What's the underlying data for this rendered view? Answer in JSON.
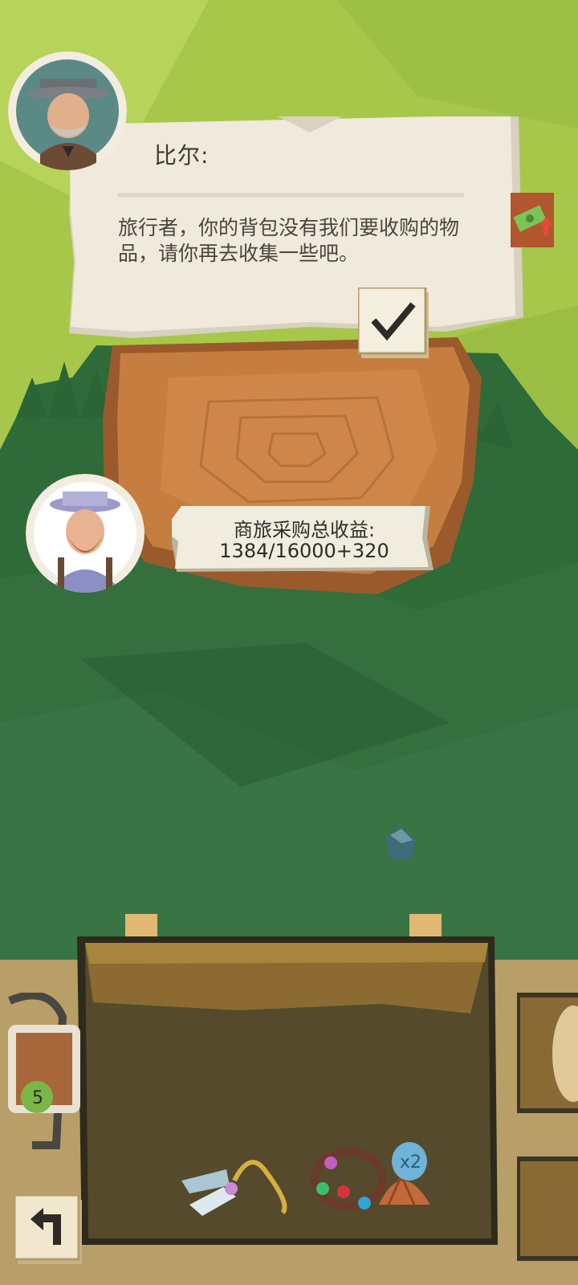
{
  "dialog": {
    "speaker": "比尔:",
    "message": "旅行者，你的背包没有我们要收购的物品，请你再去收集一些吧。",
    "confirm_icon": "checkmark-icon"
  },
  "earnings": {
    "title": "商旅采购总收益:",
    "value": "1384/16000+320"
  },
  "bag": {
    "item_count_badge": "x2",
    "items": [
      "crystal-key-necklace",
      "gem-bracelet",
      "seashell"
    ]
  },
  "tool": {
    "badge": "5"
  },
  "colors": {
    "grass_light": "#a9c94a",
    "grass_dark": "#2f6c3b",
    "wood": "#c27a3c",
    "paper": "#efeadb",
    "sand": "#b9a06b",
    "bag_dark": "#3a3524"
  }
}
